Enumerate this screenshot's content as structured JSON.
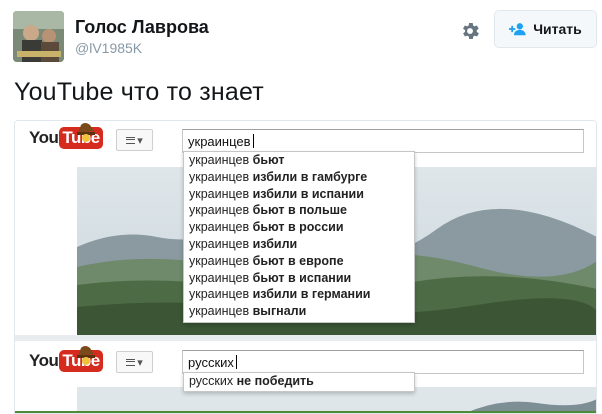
{
  "tweet": {
    "author_name": "Голос Лаврова",
    "author_handle": "@lV1985K",
    "follow_label": "Читать",
    "text": "YouTube что то знает"
  },
  "screenshot": {
    "panels": [
      {
        "logo_you": "You",
        "logo_tube": "Tube",
        "query": "украинцев",
        "suggestions": [
          {
            "prefix": "украинцев",
            "completion": "бьют"
          },
          {
            "prefix": "украинцев",
            "completion": "избили в гамбурге"
          },
          {
            "prefix": "украинцев",
            "completion": "избили в испании"
          },
          {
            "prefix": "украинцев",
            "completion": "бьют в польше"
          },
          {
            "prefix": "украинцев",
            "completion": "бьют в россии"
          },
          {
            "prefix": "украинцев",
            "completion": "избили"
          },
          {
            "prefix": "украинцев",
            "completion": "бьют в европе"
          },
          {
            "prefix": "украинцев",
            "completion": "бьют в испании"
          },
          {
            "prefix": "украинцев",
            "completion": "избили в германии"
          },
          {
            "prefix": "украинцев",
            "completion": "выгнали"
          }
        ]
      },
      {
        "logo_you": "You",
        "logo_tube": "Tube",
        "query": "русских",
        "suggestions": [
          {
            "prefix": "русских",
            "completion": "не победить"
          }
        ]
      }
    ]
  },
  "colors": {
    "youtube_red": "#d52b1e",
    "handle_gray": "#8899a6"
  },
  "icons": [
    "settings-gear-icon",
    "add-user-icon",
    "menu-icon",
    "chevron-down-icon"
  ]
}
